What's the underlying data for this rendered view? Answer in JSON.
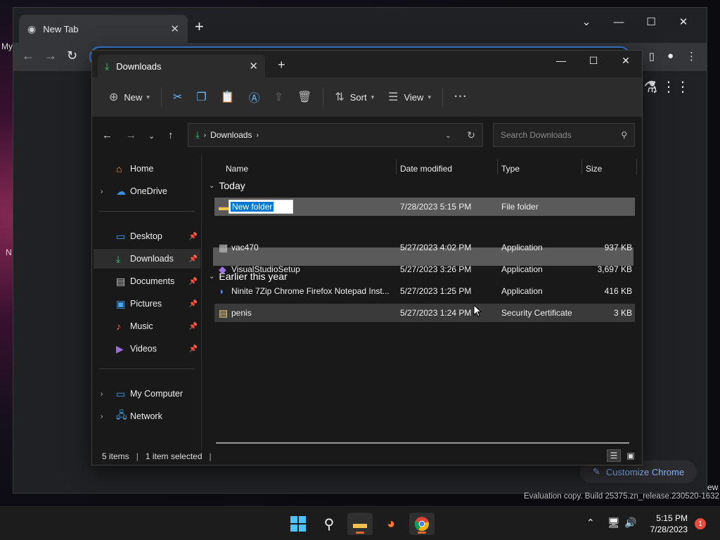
{
  "desktop": {
    "fragment_my": "My",
    "fragment_n": "N",
    "fragment_ew": "ew"
  },
  "chrome": {
    "tab_title": "New Tab",
    "customize_label": "Customize Chrome"
  },
  "explorer": {
    "tab_title": "Downloads",
    "commands": {
      "new_label": "New",
      "sort_label": "Sort",
      "view_label": "View",
      "more_label": "···"
    },
    "address": {
      "segment": "Downloads",
      "search_placeholder": "Search Downloads"
    },
    "nav": {
      "home": "Home",
      "onedrive": "OneDrive",
      "desktop": "Desktop",
      "downloads": "Downloads",
      "documents": "Documents",
      "pictures": "Pictures",
      "music": "Music",
      "videos": "Videos",
      "my_computer": "My Computer",
      "network": "Network"
    },
    "columns": {
      "name": "Name",
      "date": "Date modified",
      "type": "Type",
      "size": "Size"
    },
    "groups": {
      "today": "Today",
      "earlier": "Earlier this year"
    },
    "rename_value": "New folder",
    "today_rows": [
      {
        "name": "New folder",
        "date": "7/28/2023 5:15 PM",
        "type": "File folder",
        "size": ""
      }
    ],
    "earlier_rows": [
      {
        "name": "vac470",
        "date": "5/27/2023 4:02 PM",
        "type": "Application",
        "size": "937 KB"
      },
      {
        "name": "VisualStudioSetup",
        "date": "5/27/2023 3:26 PM",
        "type": "Application",
        "size": "3,697 KB"
      },
      {
        "name": "Ninite 7Zip Chrome Firefox Notepad Inst...",
        "date": "5/27/2023 1:25 PM",
        "type": "Application",
        "size": "416 KB"
      },
      {
        "name": "penis",
        "date": "5/27/2023 1:24 PM",
        "type": "Security Certificate",
        "size": "3 KB"
      }
    ],
    "status": {
      "items": "5 items",
      "selected": "1 item selected"
    }
  },
  "watermark": "Evaluation copy. Build 25375.zn_release.230520-1632",
  "taskbar": {
    "time": "5:15 PM",
    "date": "7/28/2023",
    "notification_count": "1"
  },
  "colors": {
    "accent": "#0078d4",
    "downloads_green": "#3ec27a",
    "folder_yellow": "#f2c14e"
  }
}
